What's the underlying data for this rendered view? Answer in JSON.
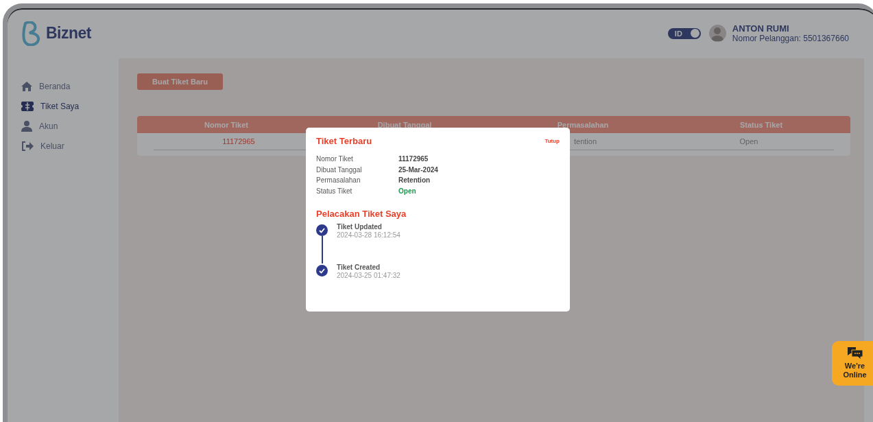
{
  "header": {
    "logo": "Biznet",
    "language_toggle": {
      "label": "ID",
      "on": true
    },
    "user": {
      "name": "ANTON RUMI",
      "customer_id": "Nomor Pelanggan: 5501367660"
    }
  },
  "sidebar": {
    "items": [
      {
        "label": "Beranda",
        "kind": "home",
        "selected": false
      },
      {
        "label": "Tiket Saya",
        "kind": "ticket",
        "selected": true
      },
      {
        "label": "Akun",
        "kind": "user",
        "selected": false
      },
      {
        "label": "Keluar",
        "kind": "logout",
        "selected": false
      }
    ]
  },
  "new_ticket_button": "Buat Tiket Baru",
  "table": {
    "columns": [
      "Nomor Tiket",
      "Dibuat Tanggal",
      "Permasalahan",
      "Status Tiket"
    ],
    "rows": [
      {
        "nomor_tiket": "11172965",
        "permasalahan": "tention",
        "status_tiket": "Open"
      }
    ]
  },
  "modal": {
    "title": "Tiket Terbaru",
    "close": "Tutup",
    "details": [
      {
        "label": "Nomor Tiket",
        "value": "11172965",
        "kind": "text"
      },
      {
        "label": "Dibuat Tanggal",
        "value": "25-Mar-2024",
        "kind": "text"
      },
      {
        "label": "Permasalahan",
        "value": "Retention",
        "kind": "text"
      },
      {
        "label": "Status Tiket",
        "value": "Open",
        "kind": "status"
      }
    ],
    "tracking_title": "Pelacakan Tiket Saya",
    "events": [
      {
        "title": "Tiket Updated",
        "time": "2024-03-28 16:12:54",
        "done": true
      },
      {
        "title": "Tiket Created",
        "time": "2024-03-25 01:47:32",
        "done": true
      }
    ]
  },
  "chat_widget": {
    "label": "We're Online"
  }
}
